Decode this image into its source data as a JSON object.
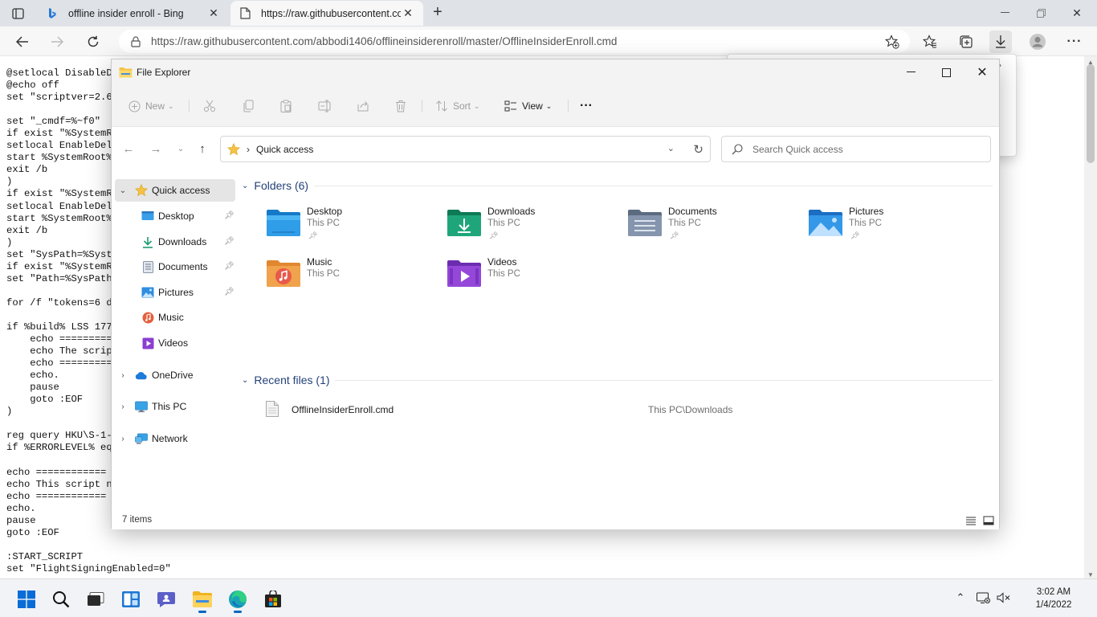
{
  "browser": {
    "tabs": [
      {
        "title": "offline insider enroll - Bing",
        "icon": "bing-icon"
      },
      {
        "title": "https://raw.githubusercontent.co",
        "icon": "page-icon"
      }
    ],
    "url": "https://raw.githubusercontent.com/abbodi1406/offlineinsiderenroll/master/OfflineInsiderEnroll.cmd"
  },
  "page": {
    "code_lines": [
      "@setlocal DisableD",
      "@echo off",
      "set \"scriptver=2.6",
      "",
      "set \"_cmdf=%~f0\"",
      "if exist \"%SystemR",
      "setlocal EnableDel",
      "start %SystemRoot%",
      "exit /b",
      ")",
      "if exist \"%SystemR",
      "setlocal EnableDel",
      "start %SystemRoot%",
      "exit /b",
      ")",
      "set \"SysPath=%Syst",
      "if exist \"%SystemR",
      "set \"Path=%SysPath",
      "",
      "for /f \"tokens=6 d",
      "",
      "if %build% LSS 177",
      "    echo ==========",
      "    echo The scrip",
      "    echo ==========",
      "    echo.",
      "    pause",
      "    goto :EOF",
      ")",
      "",
      "reg query HKU\\S-1-",
      "if %ERRORLEVEL% eq",
      "",
      "echo ============",
      "echo This script n",
      "echo ============",
      "echo.",
      "pause",
      "goto :EOF",
      "",
      ":START_SCRIPT",
      "set \"FlightSigningEnabled=0\""
    ]
  },
  "explorer": {
    "title": "File Explorer",
    "commands": {
      "new": "New",
      "sort": "Sort",
      "view": "View",
      "more": "···"
    },
    "address": "Quick access",
    "search_placeholder": "Search Quick access",
    "sidebar": {
      "quick_access": "Quick access",
      "items": [
        {
          "label": "Desktop",
          "icon": "desktop-icon"
        },
        {
          "label": "Downloads",
          "icon": "downloads-icon"
        },
        {
          "label": "Documents",
          "icon": "documents-icon"
        },
        {
          "label": "Pictures",
          "icon": "pictures-icon"
        },
        {
          "label": "Music",
          "icon": "music-icon"
        },
        {
          "label": "Videos",
          "icon": "videos-icon"
        }
      ],
      "roots": [
        {
          "label": "OneDrive",
          "icon": "onedrive-icon"
        },
        {
          "label": "This PC",
          "icon": "this-pc-icon"
        },
        {
          "label": "Network",
          "icon": "network-icon"
        }
      ]
    },
    "folders_header": "Folders (6)",
    "folders": [
      {
        "name": "Desktop",
        "location": "This PC"
      },
      {
        "name": "Downloads",
        "location": "This PC"
      },
      {
        "name": "Documents",
        "location": "This PC"
      },
      {
        "name": "Pictures",
        "location": "This PC"
      },
      {
        "name": "Music",
        "location": "This PC"
      },
      {
        "name": "Videos",
        "location": "This PC"
      }
    ],
    "recent_header": "Recent files (1)",
    "recent_files": [
      {
        "name": "OfflineInsiderEnroll.cmd",
        "location": "This PC\\Downloads"
      }
    ],
    "status": "7 items"
  },
  "taskbar": {
    "time": "3:02 AM",
    "date": "1/4/2022"
  },
  "colors": {
    "accent": "#0067c0",
    "group_header": "#24427a",
    "folder_yellow": "#f5c243"
  }
}
